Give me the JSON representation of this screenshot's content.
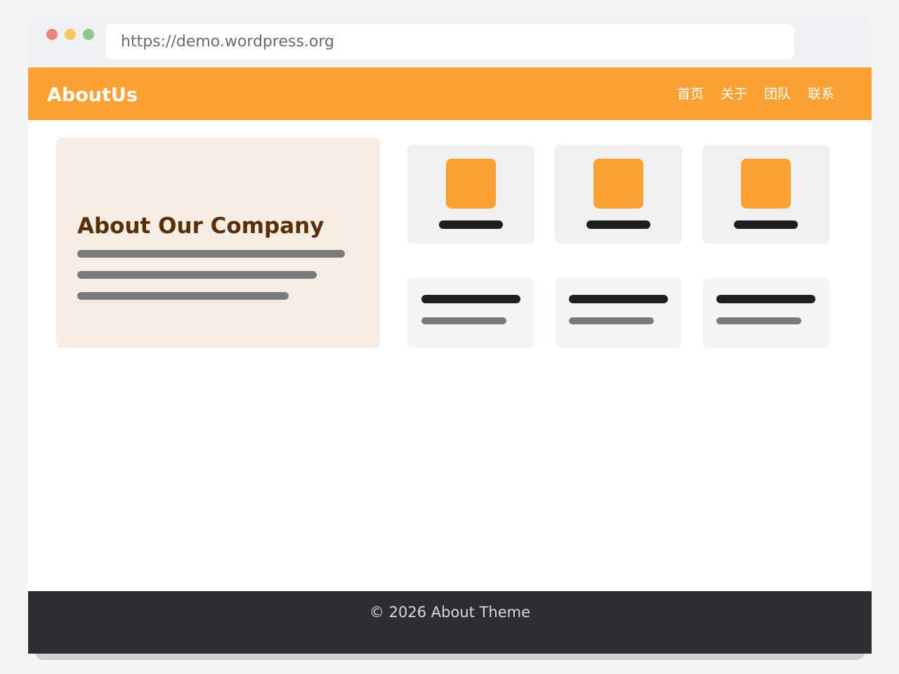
{
  "browser": {
    "url": "https://demo.wordpress.org"
  },
  "header": {
    "brand": "AboutUs",
    "nav": [
      "首页",
      "关于",
      "团队",
      "联系"
    ]
  },
  "hero": {
    "title": "About Our Company"
  },
  "footer": {
    "text": "© 2026 About Theme"
  },
  "colors": {
    "accent": "#f9a134",
    "hero_bg": "#f5ede4",
    "hero_title": "#5a2f08",
    "footer_bg": "#2d2c31"
  }
}
